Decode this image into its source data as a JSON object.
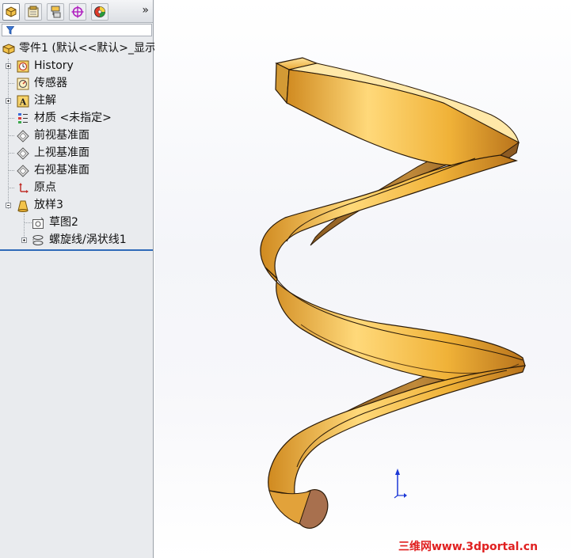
{
  "feature_manager": {
    "tabs": [
      {
        "name": "feature-manager-tab",
        "active": true
      },
      {
        "name": "property-manager-tab",
        "active": false
      },
      {
        "name": "configuration-manager-tab",
        "active": false
      },
      {
        "name": "dimxpert-manager-tab",
        "active": false
      },
      {
        "name": "display-manager-tab",
        "active": false
      }
    ],
    "more_label": "»",
    "tree": {
      "root": "零件1  (默认<<默认>_显示",
      "items": {
        "history": "History",
        "sensors": "传感器",
        "annotations": "注解",
        "material": "材质 <未指定>",
        "front_plane": "前视基准面",
        "top_plane": "上视基准面",
        "right_plane": "右视基准面",
        "origin": "原点",
        "loft": "放样3",
        "sketch": "草图2",
        "helix": "螺旋线/涡状线1"
      }
    }
  },
  "viewport": {
    "model": "helix-spring-loft",
    "colors": {
      "gold": "#f0b238",
      "gold_light": "#ffd97a",
      "gold_dark": "#b8731c",
      "end_cap": "#a8704e",
      "triad_blue": "#1c38d6"
    }
  },
  "watermark": "三维网www.3dportal.cn"
}
